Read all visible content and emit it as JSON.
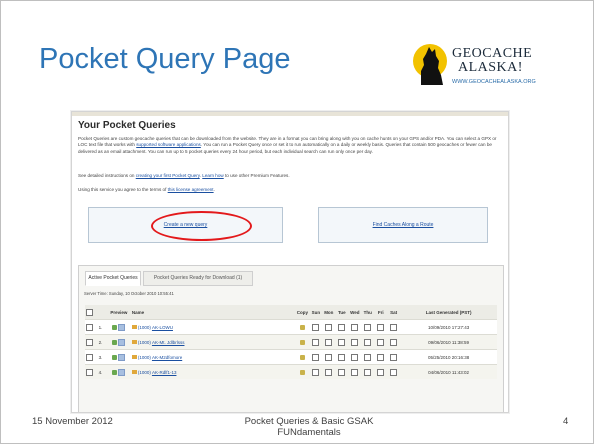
{
  "slide": {
    "title": "Pocket Query Page",
    "logo_name_line1": "GEOCACHE",
    "logo_name_line2": "ALASKA!",
    "logo_url": "WWW.GEOCACHEALASKA.ORG",
    "footer_date": "15 November 2012",
    "footer_title_line1": "Pocket Queries & Basic GSAK",
    "footer_title_line2": "FUNdamentals",
    "page_number": "4"
  },
  "screenshot": {
    "heading": "Your Pocket Queries",
    "intro_a": "Pocket Queries are custom geocache queries that can be downloaded from the website. They are in a format you can bring along with you on cache hunts on your GPS and/or PDA. You can select a GPX or LOC text file that works with ",
    "intro_link": "supported software applications",
    "intro_b": ". You can run a Pocket Query once or set it to run automatically on a daily or weekly basis. Queries that contain 500 geocaches or fewer can be delivered as an email attachment. You can run up to 5 pocket queries every 24 hour period, but each individual search can run only once per day.",
    "instr_a": "See detailed instructions on ",
    "instr_link1": "creating your first Pocket Query",
    "instr_b": ". ",
    "instr_link2": "Learn how",
    "instr_c": " to use other Premium Features.",
    "license_a": "Using this service you agree to the terms of ",
    "license_link": "this license agreement",
    "license_b": ".",
    "create_link": "Create a new query",
    "route_link": "Find Caches Along a Route",
    "tab_active": "Active Pocket Queries",
    "tab_ready": "Pocket Queries Ready for Download (1)",
    "server_time": "Server Time: Sunday, 10 October 2010 10:55:41",
    "columns": [
      "Preview",
      "Name",
      "Copy",
      "Sun",
      "Mon",
      "Tue",
      "Wed",
      "Thu",
      "Fri",
      "Sat",
      "Last Generated (PST)"
    ],
    "rows": [
      {
        "num": "1.",
        "count": "(1000)",
        "name": "AK-LOWU",
        "generated": "10/09/2010 17:27:43"
      },
      {
        "num": "2.",
        "count": "(1000)",
        "name": "AK-Mt. Jdlbrlsss",
        "generated": "09/06/2010 11:38:59"
      },
      {
        "num": "3.",
        "count": "(1000)",
        "name": "AK-M2dfomore",
        "generated": "05/25/2010 20:16:38"
      },
      {
        "num": "4.",
        "count": "(1000)",
        "name": "AK-Rdlf1-13",
        "generated": "04/06/2010 11:43:02"
      }
    ]
  },
  "colors": {
    "title": "#2e75b6",
    "highlight_oval": "#e3191b",
    "link": "#1a4fa0"
  }
}
